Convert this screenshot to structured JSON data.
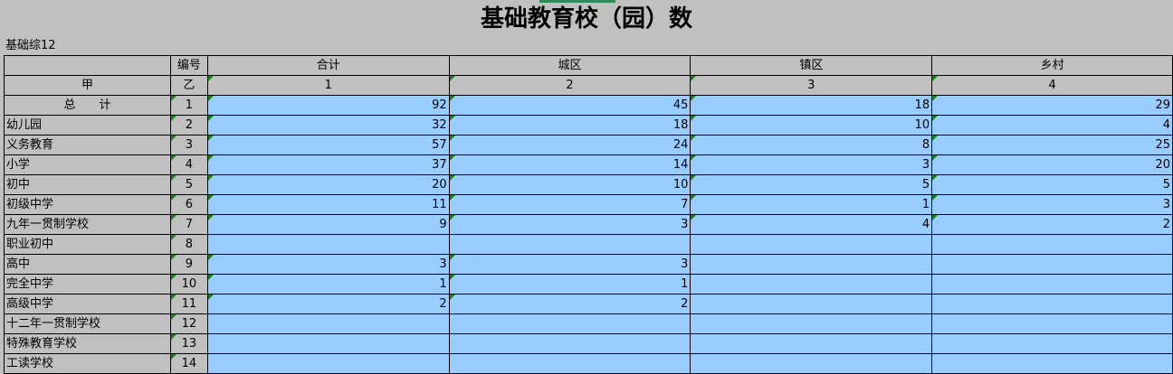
{
  "title": "基础教育校（园）数",
  "table_code": "基础综12",
  "header": {
    "row1": {
      "label": "",
      "num": "编号",
      "cols": [
        "合计",
        "城区",
        "镇区",
        "乡村"
      ]
    },
    "row2": {
      "label": "甲",
      "num": "乙",
      "cols": [
        "1",
        "2",
        "3",
        "4"
      ]
    }
  },
  "rows": [
    {
      "label": "总　　计",
      "num": "1",
      "values": [
        "92",
        "45",
        "18",
        "29"
      ]
    },
    {
      "label": "幼儿园",
      "num": "2",
      "values": [
        "32",
        "18",
        "10",
        "4"
      ]
    },
    {
      "label": "义务教育",
      "num": "3",
      "values": [
        "57",
        "24",
        "8",
        "25"
      ]
    },
    {
      "label": "小学",
      "num": "4",
      "values": [
        "37",
        "14",
        "3",
        "20"
      ]
    },
    {
      "label": "初中",
      "num": "5",
      "values": [
        "20",
        "10",
        "5",
        "5"
      ]
    },
    {
      "label": "初级中学",
      "num": "6",
      "values": [
        "11",
        "7",
        "1",
        "3"
      ]
    },
    {
      "label": "九年一贯制学校",
      "num": "7",
      "values": [
        "9",
        "3",
        "4",
        "2"
      ]
    },
    {
      "label": "职业初中",
      "num": "8",
      "values": [
        "",
        "",
        "",
        ""
      ]
    },
    {
      "label": "高中",
      "num": "9",
      "values": [
        "3",
        "3",
        "",
        ""
      ]
    },
    {
      "label": "完全中学",
      "num": "10",
      "values": [
        "1",
        "1",
        "",
        ""
      ]
    },
    {
      "label": "高级中学",
      "num": "11",
      "values": [
        "2",
        "2",
        "",
        ""
      ]
    },
    {
      "label": "十二年一贯制学校",
      "num": "12",
      "values": [
        "",
        "",
        "",
        ""
      ]
    },
    {
      "label": "特殊教育学校",
      "num": "13",
      "values": [
        "",
        "",
        "",
        ""
      ]
    },
    {
      "label": "工读学校",
      "num": "14",
      "values": [
        "",
        "",
        "",
        ""
      ]
    }
  ]
}
